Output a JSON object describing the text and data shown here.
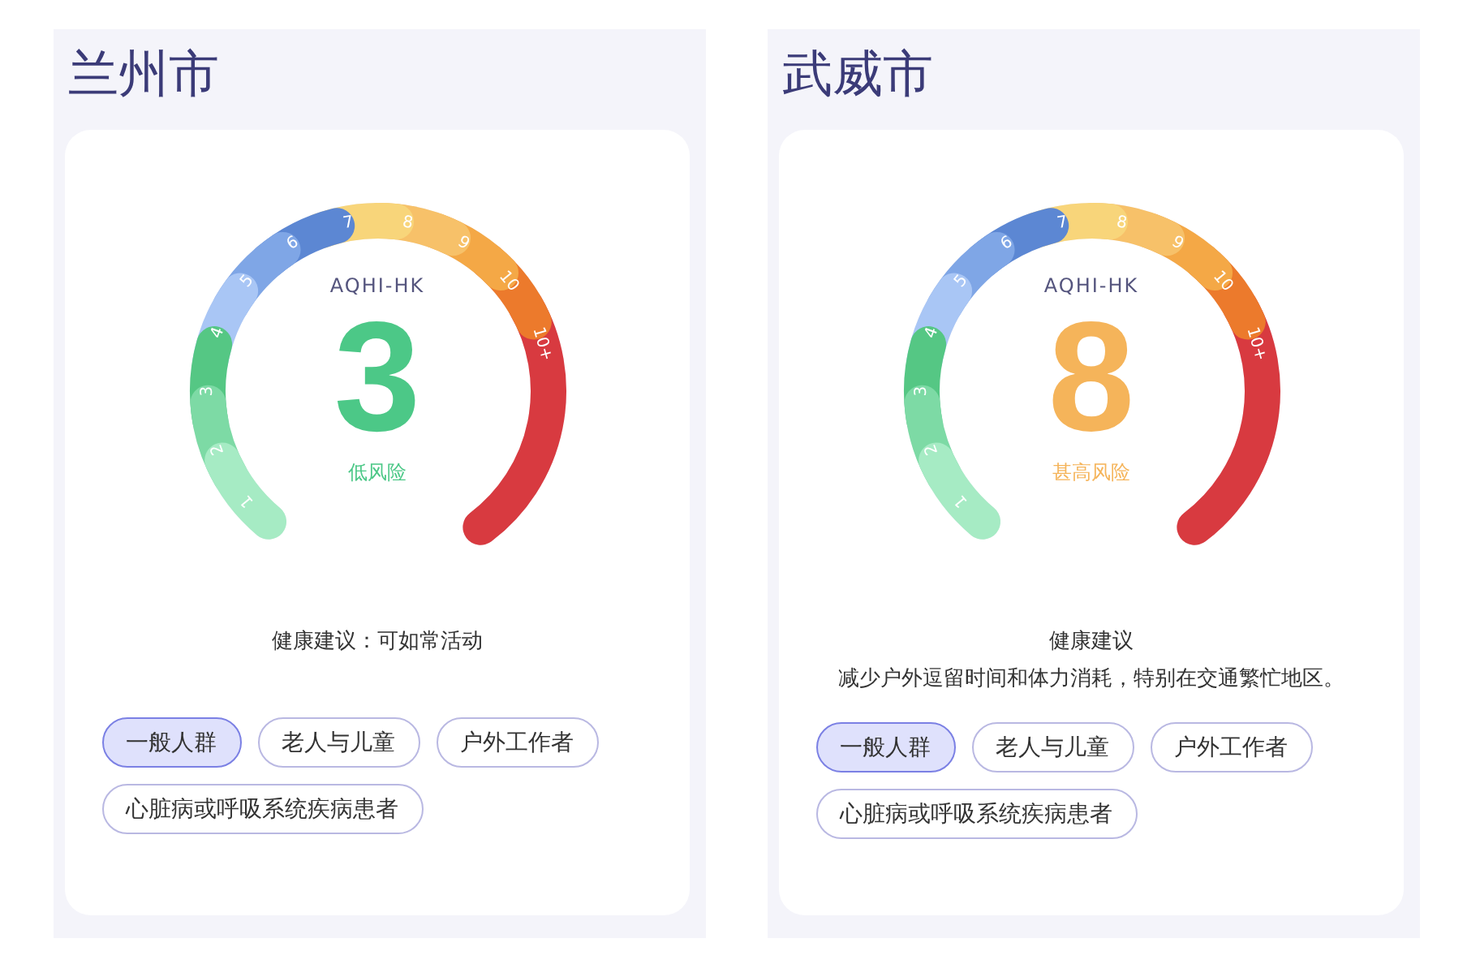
{
  "cities": [
    {
      "name": "兰州市",
      "index_name": "AQHI-HK",
      "value": "3",
      "risk": "低风险",
      "color": "#4cc887",
      "advice": [
        "健康建议：可如常活动"
      ],
      "scale": [
        {
          "label": "1",
          "color": "#a6ebc4"
        },
        {
          "label": "2",
          "color": "#7ddaa5"
        },
        {
          "label": "3",
          "color": "#55c784"
        },
        {
          "label": "4",
          "color": "#a9c6f5"
        },
        {
          "label": "5",
          "color": "#7fa6e6"
        },
        {
          "label": "6",
          "color": "#5c87d3"
        },
        {
          "label": "7",
          "color": "#f8d57a"
        },
        {
          "label": "8",
          "color": "#f7c169"
        },
        {
          "label": "9",
          "color": "#f4a846"
        },
        {
          "label": "10",
          "color": "#ec7a2c"
        },
        {
          "label": "10+",
          "color": "#d83a40"
        }
      ],
      "groups": [
        {
          "label": "一般人群",
          "selected": true
        },
        {
          "label": "老人与儿童",
          "selected": false
        },
        {
          "label": "户外工作者",
          "selected": false
        },
        {
          "label": "心脏病或呼吸系统疾病患者",
          "selected": false
        }
      ]
    },
    {
      "name": "武威市",
      "index_name": "AQHI-HK",
      "value": "8",
      "risk": "甚高风险",
      "color": "#f5b45a",
      "advice": [
        "健康建议",
        "减少户外逗留时间和体力消耗，特别在交通繁忙地区。"
      ],
      "scale": [
        {
          "label": "1",
          "color": "#a6ebc4"
        },
        {
          "label": "2",
          "color": "#7ddaa5"
        },
        {
          "label": "3",
          "color": "#55c784"
        },
        {
          "label": "4",
          "color": "#a9c6f5"
        },
        {
          "label": "5",
          "color": "#7fa6e6"
        },
        {
          "label": "6",
          "color": "#5c87d3"
        },
        {
          "label": "7",
          "color": "#f8d57a"
        },
        {
          "label": "8",
          "color": "#f7c169"
        },
        {
          "label": "9",
          "color": "#f4a846"
        },
        {
          "label": "10",
          "color": "#ec7a2c"
        },
        {
          "label": "10+",
          "color": "#d83a40"
        }
      ],
      "groups": [
        {
          "label": "一般人群",
          "selected": true
        },
        {
          "label": "老人与儿童",
          "selected": false
        },
        {
          "label": "户外工作者",
          "selected": false
        },
        {
          "label": "心脏病或呼吸系统疾病患者",
          "selected": false
        }
      ]
    }
  ]
}
